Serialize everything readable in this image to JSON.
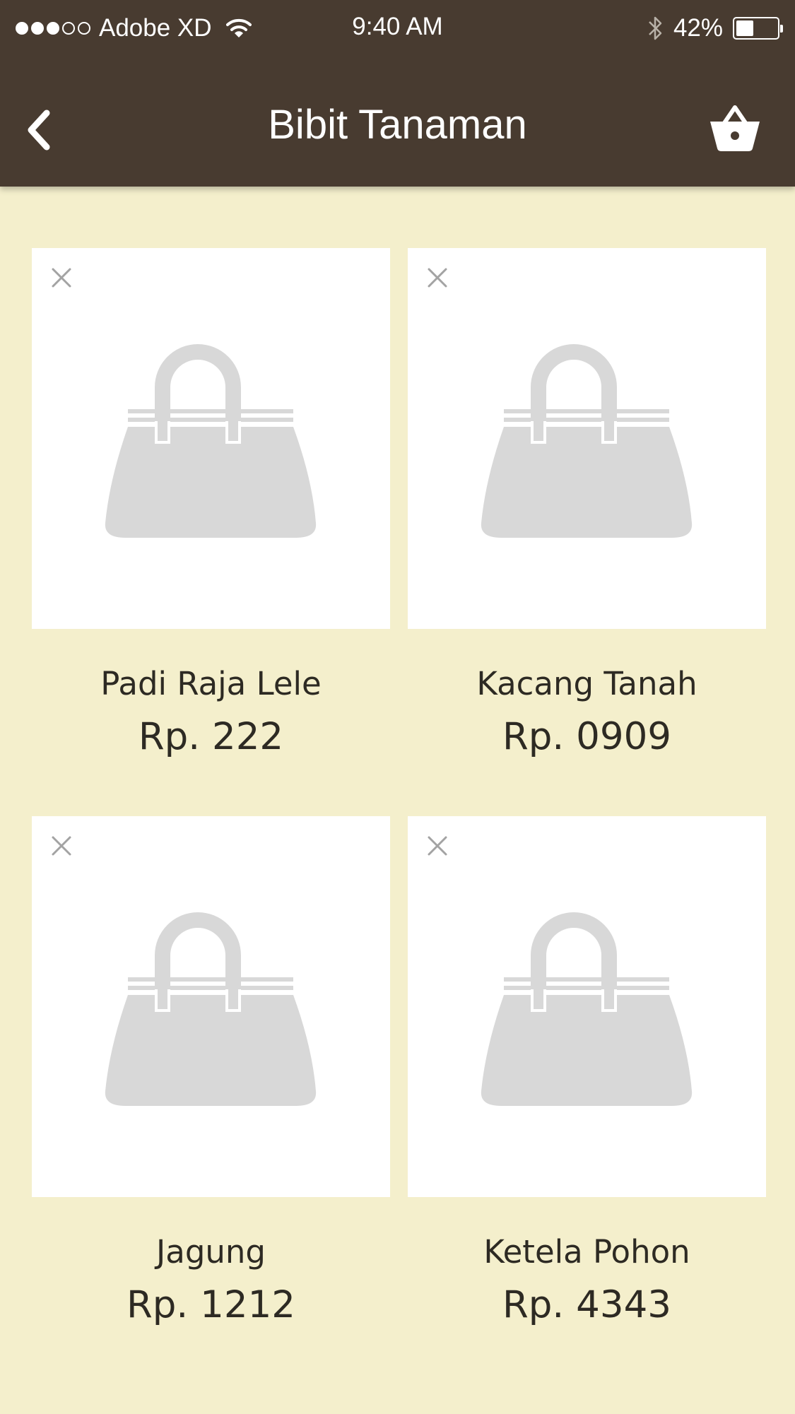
{
  "status_bar": {
    "carrier": "Adobe XD",
    "time": "9:40 AM",
    "battery_percent": "42%",
    "battery_level": 0.42,
    "signal_bars_filled": 3,
    "signal_bars_total": 5,
    "icons": [
      "wifi-icon",
      "bluetooth-icon",
      "battery-icon"
    ]
  },
  "header": {
    "title": "Bibit Tanaman",
    "back_icon": "chevron-left-icon",
    "cart_icon": "basket-icon"
  },
  "colors": {
    "header_bg": "#483b30",
    "page_bg": "#f4efcc",
    "card_bg": "#ffffff",
    "placeholder": "#d8d8d8",
    "text": "#2d2a23"
  },
  "products": [
    {
      "name": "Padi Raja Lele",
      "price": "Rp. 222",
      "remove_icon": "close-icon",
      "image_icon": "handbag-icon"
    },
    {
      "name": "Kacang Tanah",
      "price": "Rp. 0909",
      "remove_icon": "close-icon",
      "image_icon": "handbag-icon"
    },
    {
      "name": "Jagung",
      "price": "Rp. 1212",
      "remove_icon": "close-icon",
      "image_icon": "handbag-icon"
    },
    {
      "name": "Ketela Pohon",
      "price": "Rp. 4343",
      "remove_icon": "close-icon",
      "image_icon": "handbag-icon"
    }
  ]
}
